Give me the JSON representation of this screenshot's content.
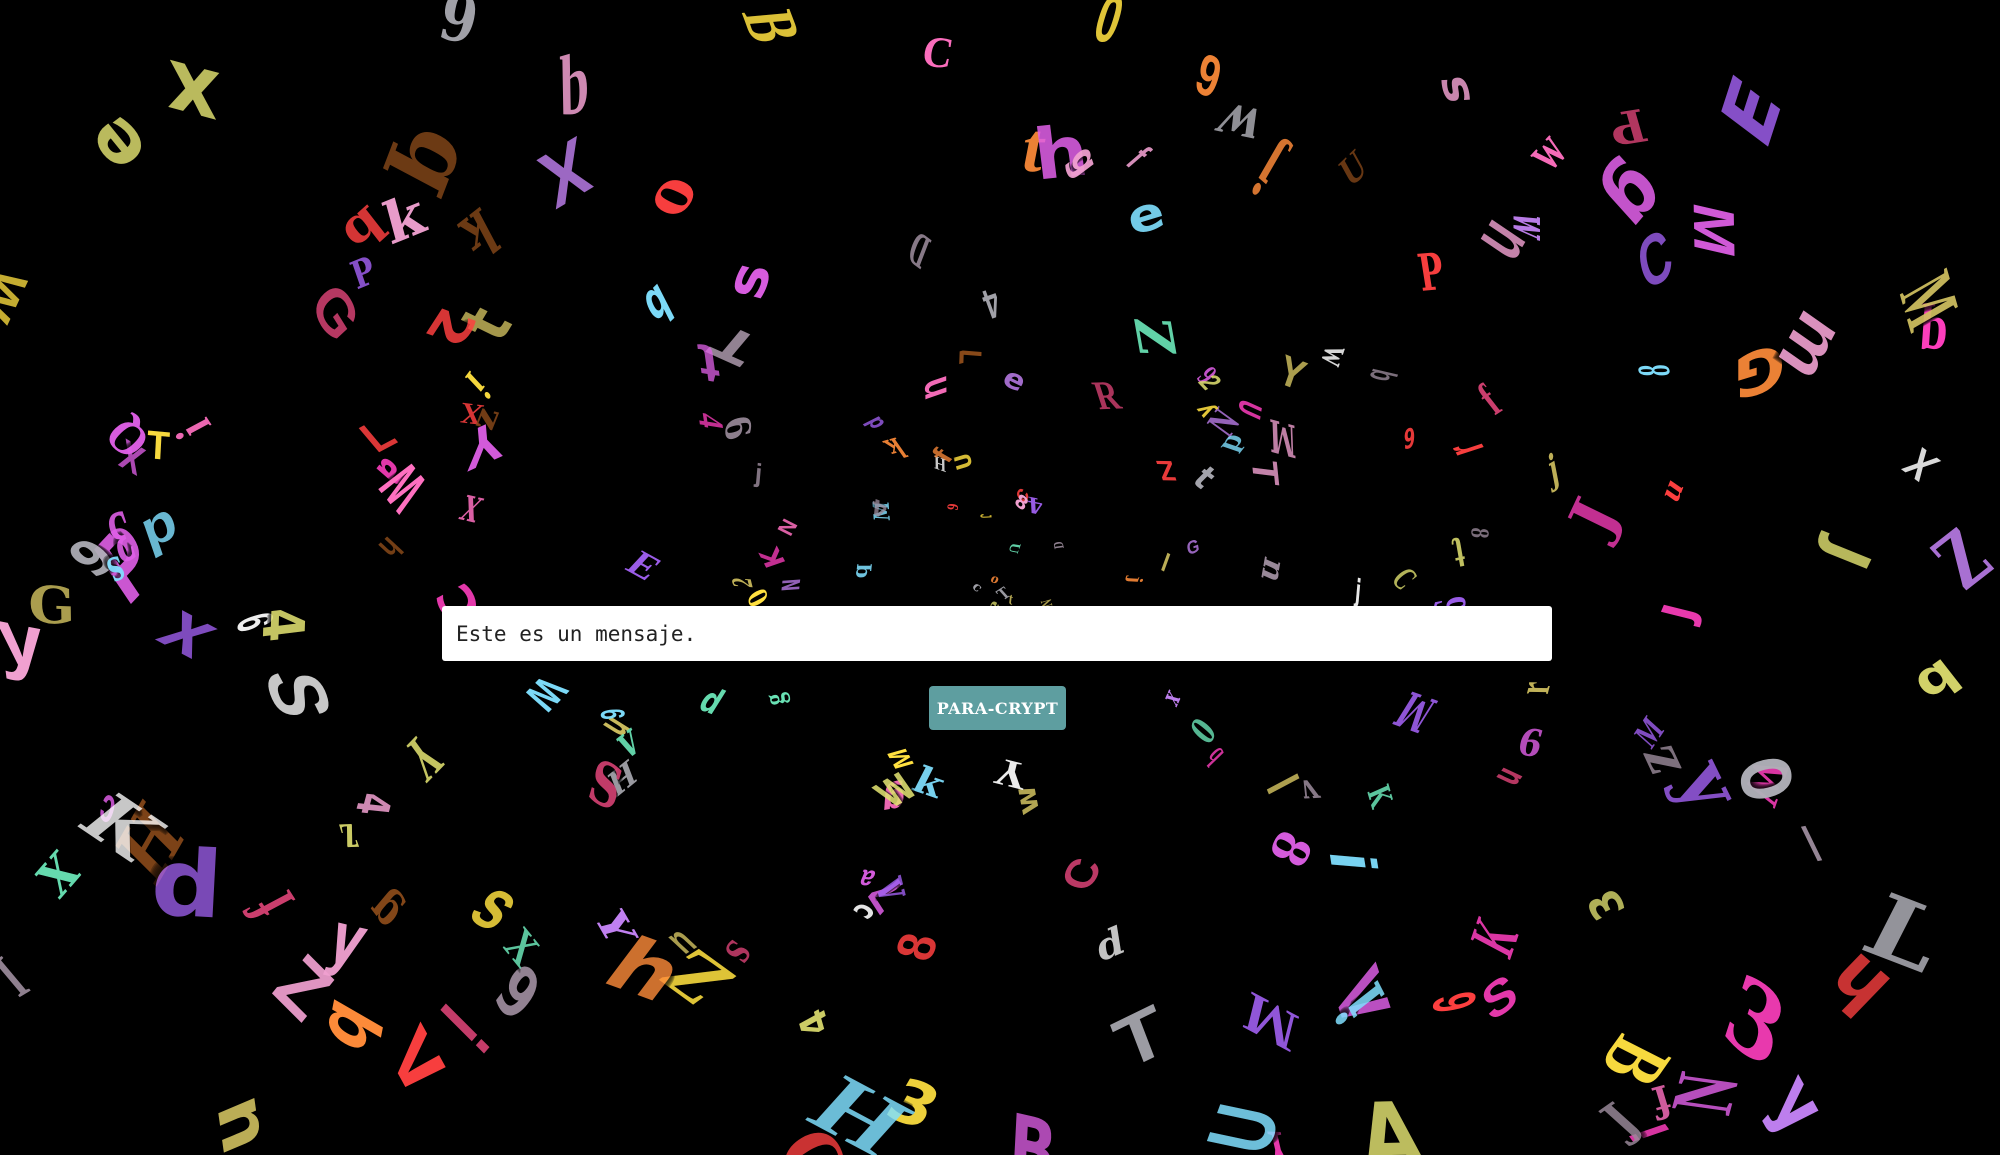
{
  "message": {
    "value": "Este es un mensaje.",
    "placeholder": ""
  },
  "action": {
    "label": "PARA-CRYPT"
  },
  "colors": {
    "background": "#000000",
    "input_background": "#ffffff",
    "button_background": "#5e9ea0",
    "button_text": "#ffffff"
  },
  "background_letters": {
    "glyphs": [
      "E",
      "H",
      "f",
      "T",
      "I",
      "K",
      "Q",
      "Y",
      "q",
      "b",
      "D",
      "S",
      "C",
      "G",
      "A",
      "2",
      "8",
      "Z",
      "N",
      "V",
      "m",
      "U",
      "y",
      "0",
      "3",
      "P",
      "R",
      "L",
      "W",
      "X",
      "a",
      "d",
      "e",
      "c",
      "7",
      "6",
      "B",
      "J",
      "M",
      "O",
      "r",
      "s",
      "t",
      "u",
      "w",
      "x",
      "z",
      "n",
      "k",
      "h",
      "g",
      "i",
      "l",
      "o",
      "p",
      "v",
      "j",
      "4",
      "9"
    ],
    "palette": [
      "#e060e8",
      "#ff3fbf",
      "#c080f0",
      "#ffe040",
      "#ff8c3a",
      "#e0e070",
      "#ffffff",
      "#b0b0b8",
      "#ff4040",
      "#80e0ff",
      "#a060f0",
      "#70f0c0",
      "#ff70c0",
      "#d04070",
      "#8a4a1a",
      "#9a8a9a",
      "#d0c060",
      "#f0a0d0"
    ]
  }
}
